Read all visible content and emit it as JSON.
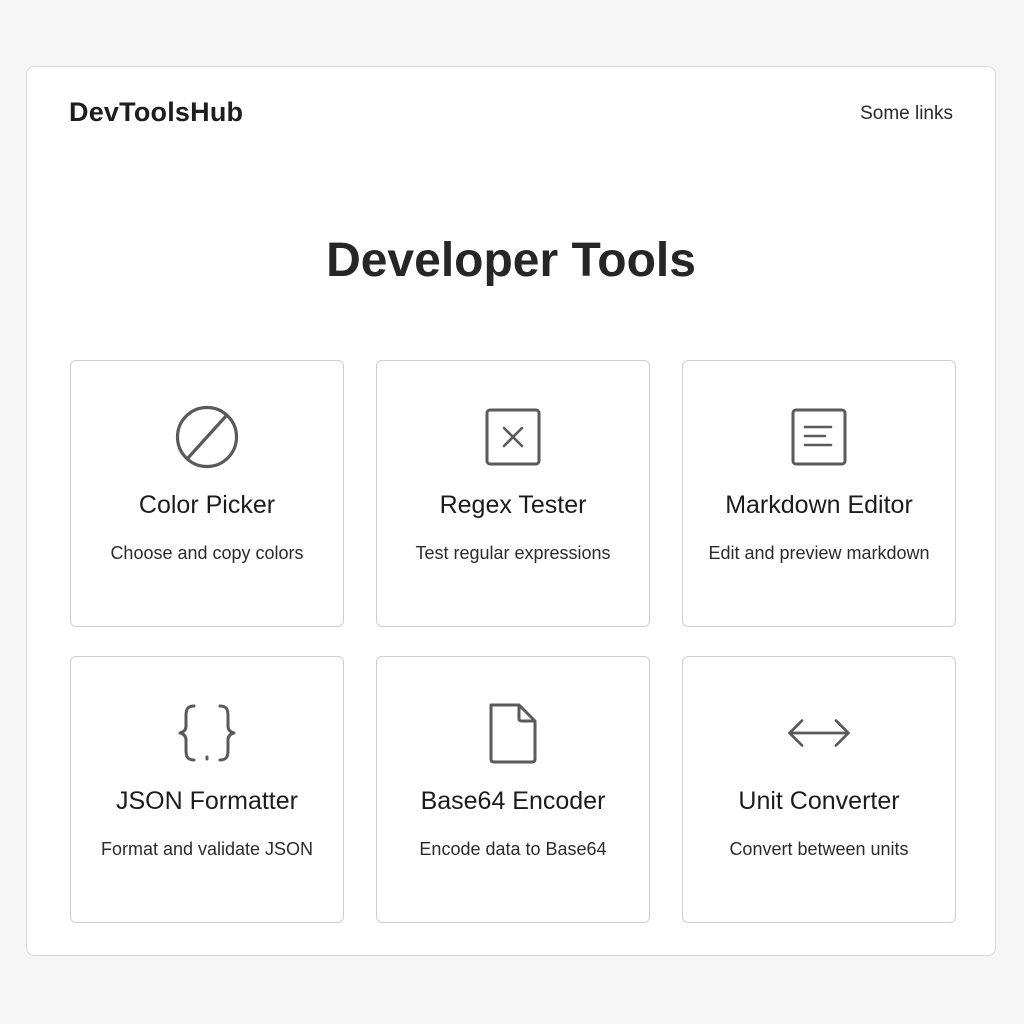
{
  "header": {
    "brand": "DevToolsHub",
    "links_label": "Some links"
  },
  "main": {
    "title": "Developer Tools"
  },
  "tools": [
    {
      "name": "Color Picker",
      "description": "Choose and copy colors",
      "icon": "color-picker-icon"
    },
    {
      "name": "Regex Tester",
      "description": "Test regular expressions",
      "icon": "regex-icon"
    },
    {
      "name": "Markdown Editor",
      "description": "Edit and preview markdown",
      "icon": "markdown-icon"
    },
    {
      "name": "JSON Formatter",
      "description": "Format and validate JSON",
      "icon": "json-braces-icon"
    },
    {
      "name": "Base64 Encoder",
      "description": "Encode data to Base64",
      "icon": "file-icon"
    },
    {
      "name": "Unit Converter",
      "description": "Convert between units",
      "icon": "double-arrow-icon"
    }
  ],
  "colors": {
    "background": "#f6f6f6",
    "panel": "#ffffff",
    "border": "#cfcfcf",
    "icon_stroke": "#555555",
    "text": "#1f1f1f"
  }
}
